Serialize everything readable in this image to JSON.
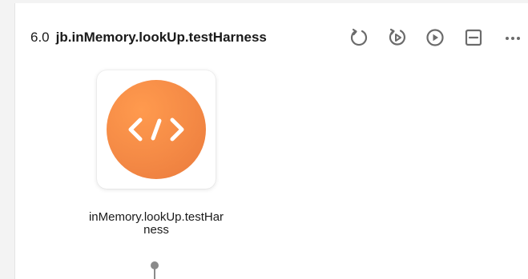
{
  "header": {
    "version": "6.0",
    "title": "jb.inMemory.lookUp.testHarness"
  },
  "toolbar": {
    "items": [
      {
        "icon": "reset-icon"
      },
      {
        "icon": "step-run-icon"
      },
      {
        "icon": "play-icon"
      },
      {
        "icon": "collapse-icon"
      },
      {
        "icon": "more-icon"
      }
    ]
  },
  "node": {
    "icon": "code-icon",
    "label": "inMemory.lookUp.testHarness"
  },
  "colors": {
    "accent": "#f58b46",
    "icon_gray": "#6b6b6b"
  }
}
